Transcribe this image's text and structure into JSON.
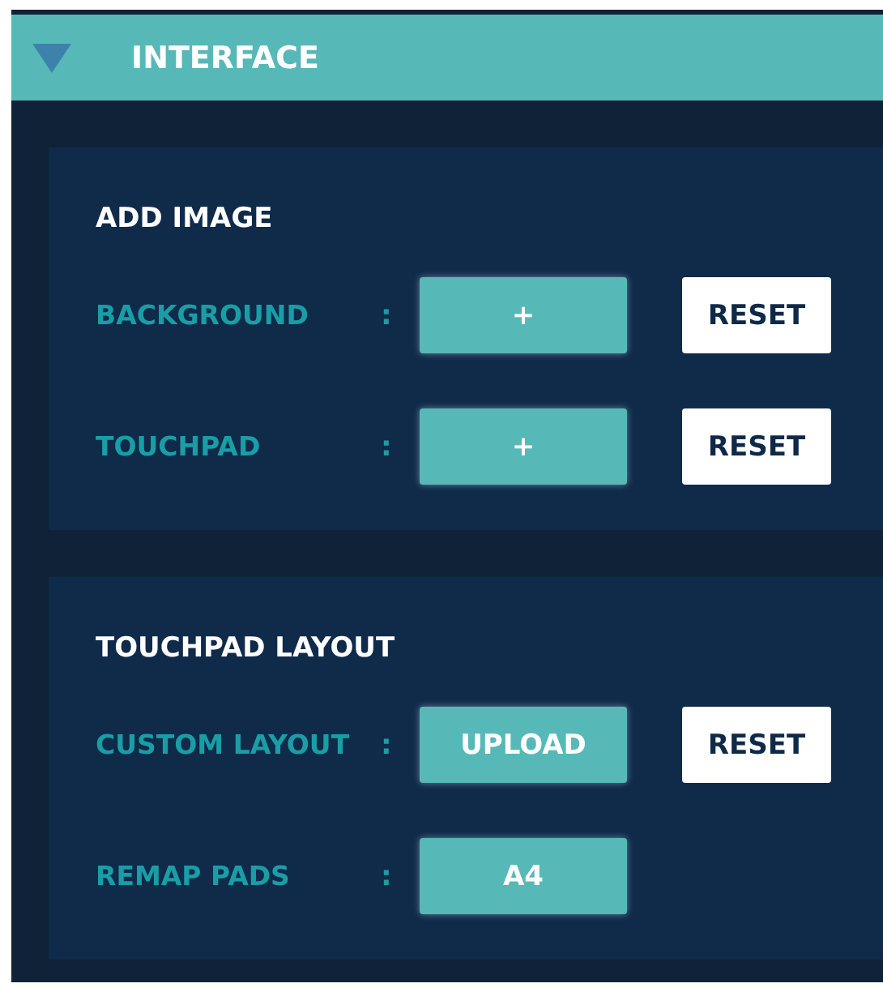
{
  "header": {
    "title": "INTERFACE",
    "expanded": true
  },
  "sections": [
    {
      "heading": "ADD IMAGE",
      "rows": [
        {
          "label": "BACKGROUND",
          "separator": ":",
          "buttons": [
            {
              "label": "+",
              "kind": "primary"
            },
            {
              "label": "RESET",
              "kind": "reset"
            }
          ]
        },
        {
          "label": "TOUCHPAD",
          "separator": ":",
          "buttons": [
            {
              "label": "+",
              "kind": "primary"
            },
            {
              "label": "RESET",
              "kind": "reset"
            }
          ]
        }
      ]
    },
    {
      "heading": "TOUCHPAD LAYOUT",
      "rows": [
        {
          "label": "CUSTOM LAYOUT",
          "separator": ":",
          "buttons": [
            {
              "label": "UPLOAD",
              "kind": "primary"
            },
            {
              "label": "RESET",
              "kind": "reset"
            }
          ]
        },
        {
          "label": "REMAP PADS",
          "separator": ":",
          "buttons": [
            {
              "label": "A4",
              "kind": "primary"
            }
          ]
        }
      ]
    }
  ]
}
